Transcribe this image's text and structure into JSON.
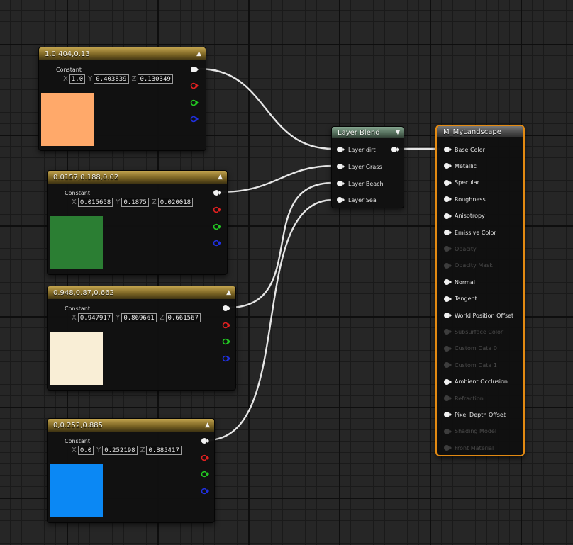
{
  "constants": [
    {
      "title": "1,0.404,0.13",
      "label": "Constant",
      "x": "1.0",
      "y": "0.403839",
      "z": "0.130349",
      "color": "#ffa96a"
    },
    {
      "title": "0.0157,0.188,0.02",
      "label": "Constant",
      "x": "0.015658",
      "y": "0.1875",
      "z": "0.020018",
      "color": "#2b7e33"
    },
    {
      "title": "0.948,0.87,0.662",
      "label": "Constant",
      "x": "0.947917",
      "y": "0.869661",
      "z": "0.661567",
      "color": "#f9eed6"
    },
    {
      "title": "0,0.252,0.885",
      "label": "Constant",
      "x": "0.0",
      "y": "0.252198",
      "z": "0.885417",
      "color": "#0b88f4"
    }
  ],
  "axis_labels": {
    "x": "X",
    "y": "Y",
    "z": "Z"
  },
  "layer_blend": {
    "title": "Layer Blend",
    "inputs": [
      "Layer dirt",
      "Layer Grass",
      "Layer Beach",
      "Layer Sea"
    ]
  },
  "material": {
    "title": "M_MyLandscape",
    "inputs": [
      {
        "label": "Base Color",
        "enabled": true
      },
      {
        "label": "Metallic",
        "enabled": true
      },
      {
        "label": "Specular",
        "enabled": true
      },
      {
        "label": "Roughness",
        "enabled": true
      },
      {
        "label": "Anisotropy",
        "enabled": true
      },
      {
        "label": "Emissive Color",
        "enabled": true
      },
      {
        "label": "Opacity",
        "enabled": false
      },
      {
        "label": "Opacity Mask",
        "enabled": false
      },
      {
        "label": "Normal",
        "enabled": true
      },
      {
        "label": "Tangent",
        "enabled": true
      },
      {
        "label": "World Position Offset",
        "enabled": true
      },
      {
        "label": "Subsurface Color",
        "enabled": false
      },
      {
        "label": "Custom Data 0",
        "enabled": false
      },
      {
        "label": "Custom Data 1",
        "enabled": false
      },
      {
        "label": "Ambient Occlusion",
        "enabled": true
      },
      {
        "label": "Refraction",
        "enabled": false
      },
      {
        "label": "Pixel Depth Offset",
        "enabled": true
      },
      {
        "label": "Shading Model",
        "enabled": false
      },
      {
        "label": "Front Material",
        "enabled": false
      }
    ]
  },
  "colors": {
    "pin_default": "#f2f2f2",
    "pin_red": "#e02020",
    "pin_green": "#22c822",
    "pin_blue": "#2030e0",
    "material_border": "#e38a12"
  }
}
